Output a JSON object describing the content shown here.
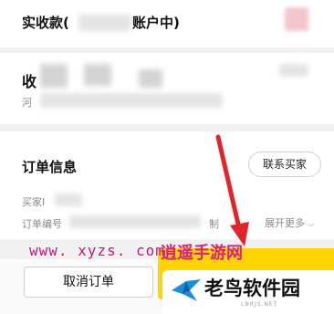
{
  "payment": {
    "received_label_prefix": "实收款(",
    "received_label_suffix": "账户中)"
  },
  "collect": {
    "label_prefix": "收",
    "sub_prefix": "河"
  },
  "order_info": {
    "title": "订单信息",
    "contact_buyer": "联系买家",
    "buyer_prefix": "买家I",
    "order_no_prefix": "订单编号",
    "order_no_suffix": "制",
    "expand_more": "展开更多"
  },
  "footer": {
    "cancel_order": "取消订单"
  },
  "watermark": {
    "url": "www. xyzs. com",
    "site": "逍遥手游网"
  },
  "logo": {
    "name": "老鸟软件园",
    "url": "LNRJS.NET"
  },
  "colors": {
    "accent_yellow": "#ffd400",
    "arrow_red": "#e0262a",
    "watermark_magenta": "#c9147d"
  }
}
